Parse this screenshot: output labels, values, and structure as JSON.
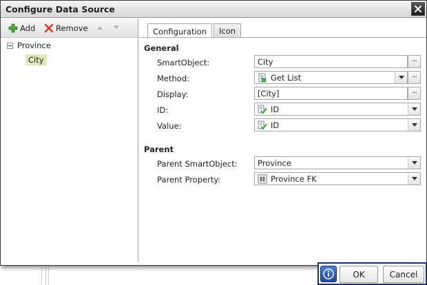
{
  "dialog": {
    "title": "Configure Data Source"
  },
  "toolbar": {
    "add_label": "Add",
    "remove_label": "Remove"
  },
  "tree": {
    "root_label": "Province",
    "child_label": "City"
  },
  "tabs": [
    {
      "label": "Configuration",
      "active": true
    },
    {
      "label": "Icon",
      "active": false
    }
  ],
  "general": {
    "heading": "General",
    "smartobject_label": "SmartObject:",
    "smartobject_value": "City",
    "method_label": "Method:",
    "method_value": "Get List",
    "display_label": "Display:",
    "display_value": "[City]",
    "id_label": "ID:",
    "id_value": "ID",
    "value_label": "Value:",
    "value_value": "ID"
  },
  "parent": {
    "heading": "Parent",
    "smartobject_label": "Parent SmartObject:",
    "smartobject_value": "Province",
    "property_label": "Parent Property:",
    "property_value": "Province FK"
  },
  "footer": {
    "ok_label": "OK",
    "cancel_label": "Cancel",
    "ellipsis": "..."
  },
  "colors": {
    "accent_border": "#1d2f6a",
    "selected_node": "#e1e8ba",
    "info_button": "#2f5fbf"
  }
}
